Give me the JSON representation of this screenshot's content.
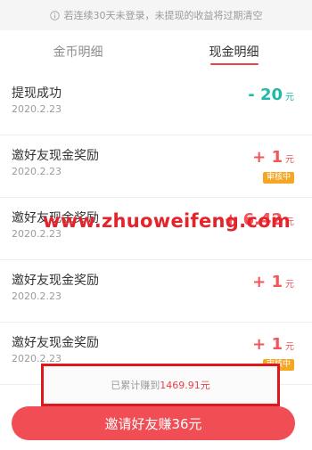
{
  "notice": {
    "text": "若连续30天未登录，未提现的收益将过期清空"
  },
  "tabs": [
    {
      "label": "金币明细"
    },
    {
      "label": "现金明细"
    }
  ],
  "rows": [
    {
      "title": "提现成功",
      "date": "2020.2.23",
      "amount": "- 20",
      "unit": "元",
      "badge": ""
    },
    {
      "title": "邀好友现金奖励",
      "date": "2020.2.23",
      "amount": "+ 1",
      "unit": "元",
      "badge": "审核中"
    },
    {
      "title": "邀好友现金奖励",
      "date": "2020.2.23",
      "amount": "+ 6.42",
      "unit": "元",
      "badge": ""
    },
    {
      "title": "邀好友现金奖励",
      "date": "2020.2.23",
      "amount": "+ 1",
      "unit": "元",
      "badge": ""
    },
    {
      "title": "邀好友现金奖励",
      "date": "2020.2.23",
      "amount": "+ 1",
      "unit": "元",
      "badge": "审核中"
    }
  ],
  "watermark": "www.zhuoweifeng.com",
  "total": {
    "prefix": "已累计赚到",
    "value": "1469.91元"
  },
  "invite_button": "邀请好友赚36元",
  "colors": {
    "accent": "#f04d55",
    "negative": "#1ebaa9",
    "badge": "#f5a623",
    "highlight_border": "#e0171d"
  }
}
